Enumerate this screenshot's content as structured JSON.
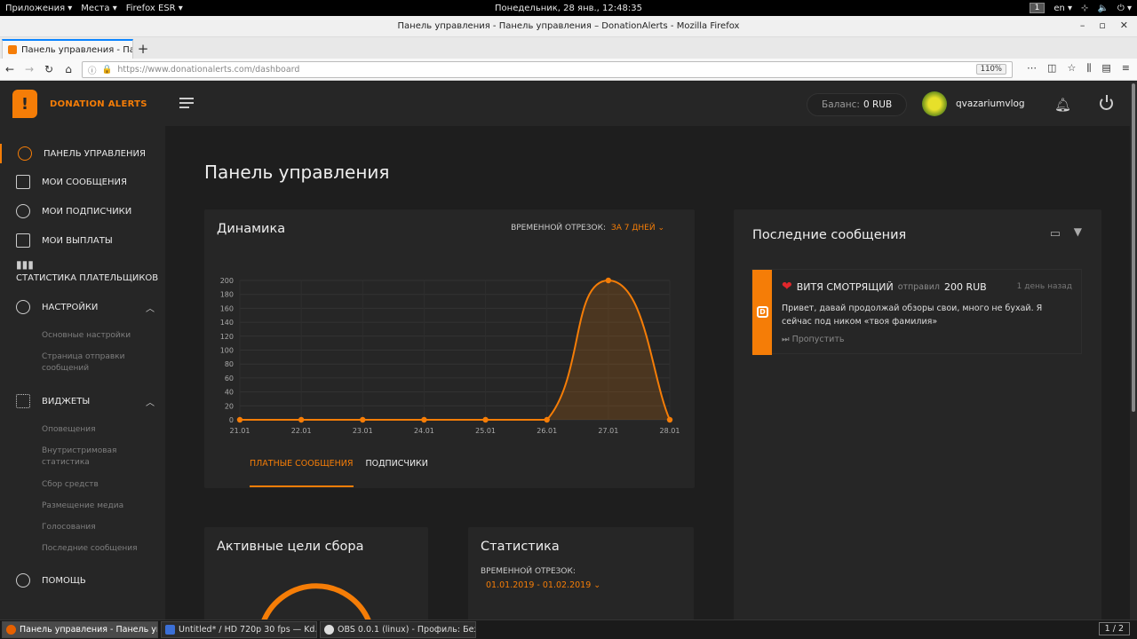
{
  "system": {
    "menu": [
      "Приложения ▾",
      "Места ▾",
      "Firefox ESR ▾"
    ],
    "clock": "Понедельник, 28 янв., 12:48:35",
    "workspace": "1",
    "lang": "en ▾"
  },
  "window": {
    "title": "Панель управления - Панель управления – DonationAlerts - Mozilla Firefox"
  },
  "browser": {
    "tab_label": "Панель управления - Па",
    "url_host": "https://www.donationalerts.com",
    "url_path": "/dashboard",
    "zoom": "110%"
  },
  "brand": {
    "name": "DONATION ALERTS"
  },
  "sidebar": {
    "items": [
      {
        "label": "Панель управления"
      },
      {
        "label": "Мои сообщения"
      },
      {
        "label": "Мои подписчики"
      },
      {
        "label": "Мои выплаты"
      },
      {
        "label": "Статистика плательщиков"
      },
      {
        "label": "Настройки"
      },
      {
        "label": "Виджеты"
      },
      {
        "label": "Помощь"
      }
    ],
    "settings_sub": [
      "Основные настройки",
      "Страница отправки сообщений"
    ],
    "widgets_sub": [
      "Оповещения",
      "Внутристримовая статистика",
      "Сбор средств",
      "Размещение медиа",
      "Голосования",
      "Последние сообщения"
    ]
  },
  "header": {
    "balance_label": "Баланс:",
    "balance_value": "0 RUB",
    "username": "qvazariumvlog"
  },
  "page": {
    "title": "Панель управления"
  },
  "dynamics": {
    "title": "Динамика",
    "period_label": "Временной отрезок:",
    "period_value": "За 7 дней ⌄",
    "tab_paid": "Платные сообщения",
    "tab_subs": "Подписчики"
  },
  "chart_data": {
    "type": "area",
    "x": [
      "21.01",
      "22.01",
      "23.01",
      "24.01",
      "25.01",
      "26.01",
      "27.01",
      "28.01"
    ],
    "values": [
      0,
      0,
      0,
      0,
      0,
      0,
      200,
      0
    ],
    "yticks": [
      0,
      20,
      40,
      60,
      80,
      100,
      120,
      140,
      160,
      180,
      200
    ],
    "ylim": [
      0,
      200
    ],
    "grid": true,
    "color": "#f57d07"
  },
  "messages": {
    "title": "Последние сообщения",
    "items": [
      {
        "name": "Витя смотрящий",
        "sent": "отправил",
        "amount": "200 RUB",
        "time": "1 день назад",
        "text": "Привет, давай продолжай обзоры свои, много не бухай. Я сейчас под ником «твоя фамилия»",
        "skip": "⏭ Пропустить"
      }
    ]
  },
  "goals": {
    "title": "Активные цели сбора"
  },
  "stats": {
    "title": "Статистика",
    "period_label": "Временной отрезок:",
    "period_value": "01.01.2019 - 01.02.2019 ⌄"
  },
  "taskbar": {
    "tasks": [
      "Панель управления - Панель упр...",
      "Untitled* / HD 720p 30 fps — Kd...",
      "OBS 0.0.1 (linux) - Профиль: Без..."
    ],
    "pager": "1 / 2"
  }
}
